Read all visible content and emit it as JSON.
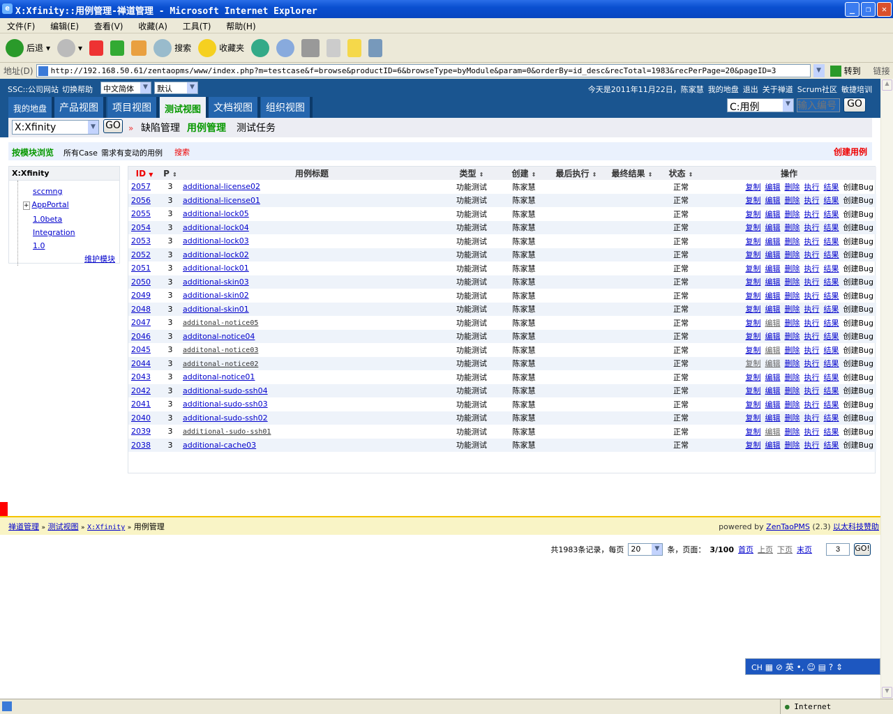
{
  "window": {
    "title": "X:Xfinity::用例管理-禅道管理 - Microsoft Internet Explorer"
  },
  "menu": [
    "文件(F)",
    "编辑(E)",
    "查看(V)",
    "收藏(A)",
    "工具(T)",
    "帮助(H)"
  ],
  "toolbar": {
    "back": "后退",
    "search": "搜索",
    "favorites": "收藏夹"
  },
  "address": {
    "label": "地址(D)",
    "url": "http://192.168.50.61/zentaopms/www/index.php?m=testcase&f=browse&productID=6&browseType=byModule&param=0&orderBy=id_desc&recTotal=1983&recPerPage=20&pageID=3",
    "go": "转到",
    "links": "链接"
  },
  "topbar": {
    "company": "SSC::公司网站",
    "switch_help": "切换帮助",
    "lang": "中文简体",
    "theme": "默认",
    "date": "今天是2011年11月22日，",
    "user": "陈家慧",
    "my": "我的地盘",
    "logout": "退出",
    "about": "关于禅道",
    "scrum": "Scrum社区",
    "agile": "敏捷培训"
  },
  "nav": {
    "tabs": [
      "我的地盘",
      "产品视图",
      "项目视图",
      "测试视图",
      "文档视图",
      "组织视图"
    ],
    "search_type": "C:用例",
    "search_placeholder": "输入编号",
    "go": "GO"
  },
  "subnav": {
    "product": "X:Xfinity",
    "go": "GO",
    "items": [
      "缺陷管理",
      "用例管理",
      "测试任务"
    ]
  },
  "modbar": {
    "by_module": "按模块浏览",
    "all": "所有Case",
    "changed": "需求有变动的用例",
    "search": "搜索",
    "create": "创建用例"
  },
  "tree": {
    "title": "X:Xfinity",
    "items": [
      "sccmng",
      "AppPortal",
      "1.0beta",
      "Integration",
      "1.0"
    ],
    "maintain": "维护模块"
  },
  "table": {
    "headers": [
      "ID",
      "P",
      "用例标题",
      "类型",
      "创建",
      "最后执行",
      "最终结果",
      "状态",
      "操作"
    ],
    "ops": [
      "复制",
      "编辑",
      "删除",
      "执行",
      "结果",
      "创建Bug"
    ],
    "rows": [
      [
        "2057",
        "3",
        "additional-license02",
        "功能测试",
        "陈家慧",
        "",
        "",
        "正常",
        0
      ],
      [
        "2056",
        "3",
        "additional-license01",
        "功能测试",
        "陈家慧",
        "",
        "",
        "正常",
        0
      ],
      [
        "2055",
        "3",
        "additional-lock05",
        "功能测试",
        "陈家慧",
        "",
        "",
        "正常",
        0
      ],
      [
        "2054",
        "3",
        "additional-lock04",
        "功能测试",
        "陈家慧",
        "",
        "",
        "正常",
        0
      ],
      [
        "2053",
        "3",
        "additional-lock03",
        "功能测试",
        "陈家慧",
        "",
        "",
        "正常",
        0
      ],
      [
        "2052",
        "3",
        "additional-lock02",
        "功能测试",
        "陈家慧",
        "",
        "",
        "正常",
        0
      ],
      [
        "2051",
        "3",
        "additional-lock01",
        "功能测试",
        "陈家慧",
        "",
        "",
        "正常",
        0
      ],
      [
        "2050",
        "3",
        "additional-skin03",
        "功能测试",
        "陈家慧",
        "",
        "",
        "正常",
        0
      ],
      [
        "2049",
        "3",
        "additional-skin02",
        "功能测试",
        "陈家慧",
        "",
        "",
        "正常",
        0
      ],
      [
        "2048",
        "3",
        "additional-skin01",
        "功能测试",
        "陈家慧",
        "",
        "",
        "正常",
        0
      ],
      [
        "2047",
        "3",
        "additonal-notice05",
        "功能测试",
        "陈家慧",
        "",
        "",
        "正常",
        1
      ],
      [
        "2046",
        "3",
        "additonal-notice04",
        "功能测试",
        "陈家慧",
        "",
        "",
        "正常",
        0
      ],
      [
        "2045",
        "3",
        "additonal-notice03",
        "功能测试",
        "陈家慧",
        "",
        "",
        "正常",
        1
      ],
      [
        "2044",
        "3",
        "additonal-notice02",
        "功能测试",
        "陈家慧",
        "",
        "",
        "正常",
        1
      ],
      [
        "2043",
        "3",
        "additonal-notice01",
        "功能测试",
        "陈家慧",
        "",
        "",
        "正常",
        0
      ],
      [
        "2042",
        "3",
        "additional-sudo-ssh04",
        "功能测试",
        "陈家慧",
        "",
        "",
        "正常",
        0
      ],
      [
        "2041",
        "3",
        "additional-sudo-ssh03",
        "功能测试",
        "陈家慧",
        "",
        "",
        "正常",
        0
      ],
      [
        "2040",
        "3",
        "additional-sudo-ssh02",
        "功能测试",
        "陈家慧",
        "",
        "",
        "正常",
        0
      ],
      [
        "2039",
        "3",
        "additional-sudo-ssh01",
        "功能测试",
        "陈家慧",
        "",
        "",
        "正常",
        1
      ],
      [
        "2038",
        "3",
        "additional-cache03",
        "功能测试",
        "陈家慧",
        "",
        "",
        "正常",
        0
      ]
    ]
  },
  "pager": {
    "total": "共1983条记录，每页",
    "per_page": "20",
    "unit": "条，页面：",
    "pages": "3/100",
    "first": "首页",
    "prev": "上页",
    "next": "下页",
    "last": "末页",
    "page_input": "3",
    "go": "GO!"
  },
  "footer": {
    "crumbs": [
      "禅道管理",
      "测试视图",
      "X:Xfinity",
      "用例管理"
    ],
    "powered": "powered by",
    "zentao": "ZenTaoPMS",
    "version": "(2.3)",
    "sponsor": "以太科技赞助"
  },
  "status": {
    "zone": "Internet"
  },
  "ime": {
    "label": "CH",
    "mode": "英"
  }
}
